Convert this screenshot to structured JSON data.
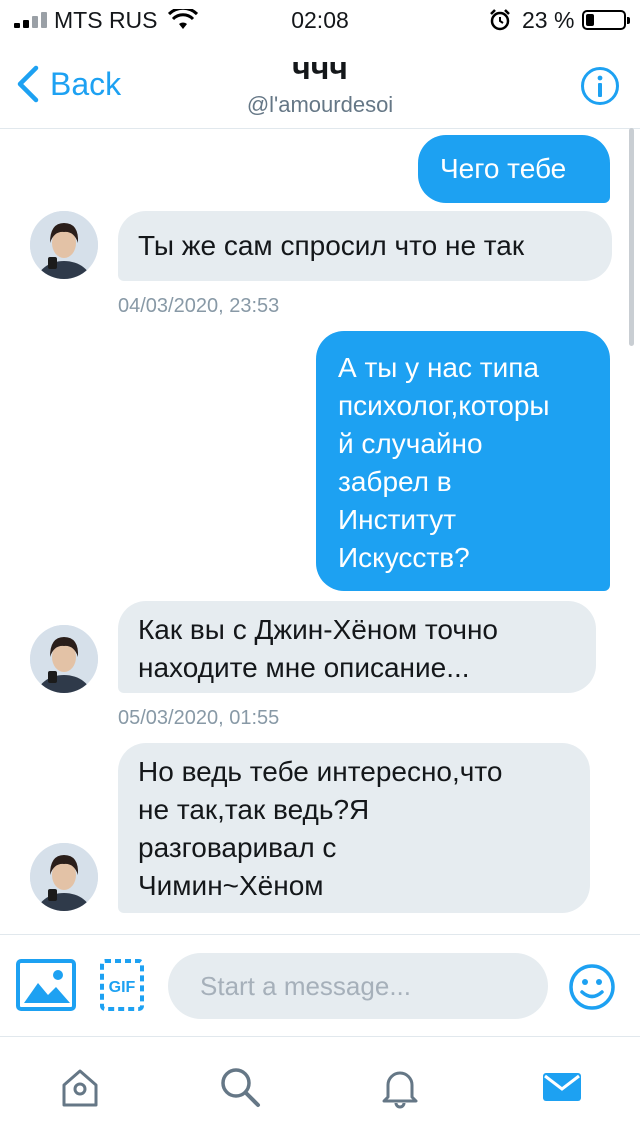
{
  "status_bar": {
    "carrier": "MTS RUS",
    "time": "02:08",
    "battery_percent": "23 %",
    "battery_level": 0.23
  },
  "header": {
    "back_label": "Back",
    "title": "ччч",
    "handle": "@l'amourdesoi"
  },
  "messages": [
    {
      "direction": "outgoing",
      "text": "Чего тебе"
    },
    {
      "direction": "incoming",
      "text": "Ты же сам спросил что не так"
    },
    {
      "timestamp": "04/03/2020, 23:53"
    },
    {
      "direction": "outgoing",
      "lines": [
        "А ты у нас типа",
        "психолог,которы",
        "й случайно",
        "забрел в",
        "Институт",
        "Искусств?"
      ]
    },
    {
      "direction": "incoming",
      "lines": [
        "Как вы с Джин-Хёном точно",
        "находите мне описание..."
      ]
    },
    {
      "timestamp": "05/03/2020, 01:55"
    },
    {
      "direction": "incoming",
      "lines": [
        "Но ведь тебе интересно,что",
        "не так,так ведь?Я",
        "разговаривал с",
        "Чимин~Хёном"
      ]
    }
  ],
  "composer": {
    "placeholder": "Start a message...",
    "value": ""
  },
  "icons": {
    "media": "image-icon",
    "gif": "gif-icon",
    "emoji": "emoji-icon",
    "tabs": [
      "home-icon",
      "search-icon",
      "notifications-icon",
      "messages-icon"
    ]
  },
  "colors": {
    "accent": "#1da1f2",
    "incoming_bubble": "#e6ecf0",
    "muted_text": "#8899a6"
  }
}
